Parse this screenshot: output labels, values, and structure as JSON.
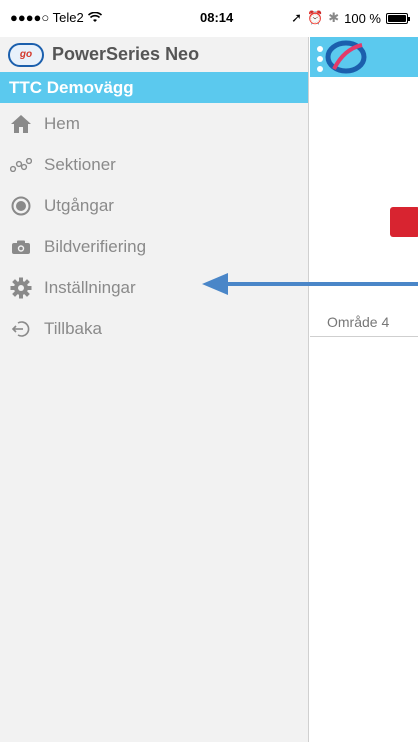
{
  "status_bar": {
    "carrier": "●●●●○ Tele2",
    "time": "08:14",
    "battery": "100 %",
    "battery_level": 1.0
  },
  "drawer": {
    "app_title": "PowerSeries Neo",
    "site_name": "TTC Demovägg",
    "items": [
      {
        "label": "Hem",
        "icon": "home-icon"
      },
      {
        "label": "Sektioner",
        "icon": "sections-icon"
      },
      {
        "label": "Utgångar",
        "icon": "outputs-icon"
      },
      {
        "label": "Bildverifiering",
        "icon": "camera-icon"
      },
      {
        "label": "Inställningar",
        "icon": "gear-icon"
      },
      {
        "label": "Tillbaka",
        "icon": "back-icon"
      }
    ]
  },
  "main": {
    "area_label": "Område 4"
  },
  "colors": {
    "accent": "#5bc9ee",
    "menu_text": "#8a8a8a",
    "alarm_red": "#d82430",
    "arrow": "#4a86c8"
  }
}
